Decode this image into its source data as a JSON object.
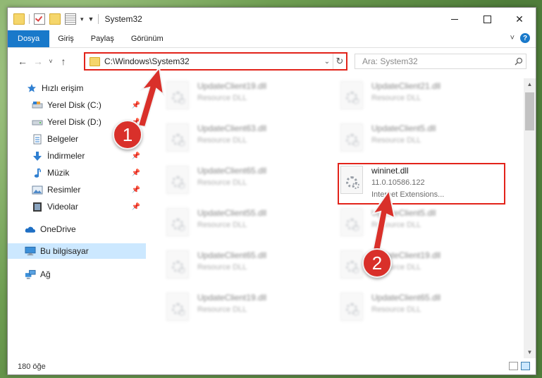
{
  "window": {
    "title": "System32",
    "controls": {
      "minimize": "",
      "maximize": "",
      "close": "✕"
    }
  },
  "ribbon": {
    "tabs": [
      {
        "label": "Dosya"
      },
      {
        "label": "Giriş"
      },
      {
        "label": "Paylaş"
      },
      {
        "label": "Görünüm"
      }
    ],
    "help_label": "?"
  },
  "navigation": {
    "back": "←",
    "forward": "→",
    "recent": "˅",
    "up": "↑",
    "address_path": "C:\\Windows\\System32",
    "refresh": "↻",
    "search_placeholder": "Ara: System32"
  },
  "sidebar": {
    "items": [
      {
        "label": "Hızlı erişim",
        "icon": "star-icon",
        "pinned": false
      },
      {
        "label": "Yerel Disk (C:)",
        "icon": "drive-c-icon",
        "pinned": true
      },
      {
        "label": "Yerel Disk (D:)",
        "icon": "drive-d-icon",
        "pinned": true
      },
      {
        "label": "Belgeler",
        "icon": "documents-icon",
        "pinned": true
      },
      {
        "label": "İndirmeler",
        "icon": "downloads-icon",
        "pinned": true
      },
      {
        "label": "Müzik",
        "icon": "music-icon",
        "pinned": true
      },
      {
        "label": "Resimler",
        "icon": "pictures-icon",
        "pinned": true
      },
      {
        "label": "Videolar",
        "icon": "videos-icon",
        "pinned": true
      },
      {
        "label": "OneDrive",
        "icon": "cloud-icon",
        "pinned": false
      },
      {
        "label": "Bu bilgisayar",
        "icon": "computer-icon",
        "pinned": false,
        "selected": true
      },
      {
        "label": "Ağ",
        "icon": "network-icon",
        "pinned": false
      }
    ],
    "pin_glyph": "📌"
  },
  "files": {
    "left_column": [
      {
        "name": "UpdateClient19.dll",
        "desc": "Resource DLL"
      },
      {
        "name": "UpdateClient63.dll",
        "desc": "Resource DLL"
      },
      {
        "name": "UpdateClient65.dll",
        "desc": "Resource DLL"
      },
      {
        "name": "UpdateClient55.dll",
        "desc": "Resource DLL"
      },
      {
        "name": "UpdateClient65.dll",
        "desc": "Resource DLL"
      },
      {
        "name": "UpdateClient19.dll",
        "desc": "Resource DLL"
      }
    ],
    "right_column": [
      {
        "name": "UpdateClient21.dll",
        "desc": "Resource DLL"
      },
      {
        "name": "UpdateClient5.dll",
        "desc": "Resource DLL"
      },
      {
        "name": "UpdateClient5.dll",
        "desc": "Resource DLL"
      },
      {
        "name": "UpdateClient19.dll",
        "desc": "Resource DLL"
      },
      {
        "name": "UpdateClient65.dll",
        "desc": "Resource DLL"
      }
    ],
    "highlighted": {
      "name": "wininet.dll",
      "version": "11.0.10586.122",
      "desc": "Internet Extensions..."
    }
  },
  "status": {
    "item_count": "180 öğe"
  },
  "markers": {
    "one": "1",
    "two": "2"
  },
  "colors": {
    "accent": "#1979ca",
    "highlight_box": "#e2231a",
    "marker": "#d9302a",
    "selected_bg": "#cce8ff"
  }
}
